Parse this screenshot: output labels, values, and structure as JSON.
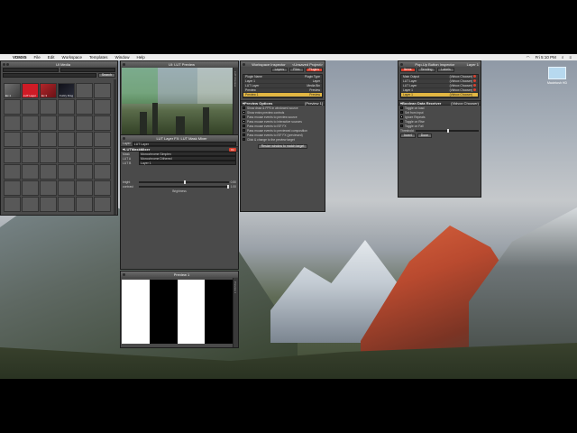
{
  "menubar": {
    "apple": "",
    "app_name": "VDMX5",
    "menus": [
      "File",
      "Edit",
      "Workspace",
      "Templates",
      "Window",
      "Help"
    ],
    "clock": "Fri 5:10 PM"
  },
  "media_panel": {
    "title": "UI Media",
    "search_label": "Search",
    "clips": [
      {
        "label": "Ex 1",
        "style": "grey-thumb"
      },
      {
        "label": "LUT Layer",
        "style": "red-thumb"
      },
      {
        "label": "Ex 3",
        "style": "red2-thumb"
      },
      {
        "label": "Fuzzy Frog",
        "style": "dark-thumb"
      }
    ]
  },
  "lut_preview": {
    "title": "UI: LUT Preview",
    "side_label": "LUT Preview"
  },
  "lut_fx": {
    "title": "LUT Layer FX: LUT Mask Mixer",
    "layer_label": "Layer",
    "layer_value": "LUT Layer",
    "section_title": "LUTMaskMixer",
    "on_label": "On",
    "rows": [
      {
        "label": "Mask",
        "value": "Monochrome Simplex"
      },
      {
        "label": "LUT A",
        "value": "Monochrome Dithered"
      },
      {
        "label": "LUT B",
        "value": "Layer 1"
      }
    ],
    "bright_label": "bright",
    "contrast_label": "contrast",
    "bright_value": "0.50",
    "contrast_value": "1.00",
    "bright_level": 0.5,
    "contrast_level": 1.0,
    "footer": "Brightness"
  },
  "preview1": {
    "title": "Preview 1",
    "side_label": "Preview 1"
  },
  "workspace_inspector": {
    "title": "Workspace Inspector",
    "project": "<Unsaved Project>",
    "tabs": [
      "Layers",
      "Files",
      "Plugins"
    ],
    "list": [
      {
        "name": "Plugin Name",
        "type": "Plugin Type"
      },
      {
        "name": "Layer 1",
        "type": "Layer"
      },
      {
        "name": "LUT Layer",
        "type": "Media Bin"
      },
      {
        "name": "Preview",
        "type": "Preview"
      },
      {
        "name": "Preview 1",
        "type": "Preview"
      }
    ],
    "options_title": "Preview Options",
    "options_tag": "[Preview 1]",
    "options": [
      "Show draw & FPS in windowed source",
      "Show extra preview controls",
      "Pass mouse events to preview source",
      "Pass mouse events to interactive sources",
      "Pass mouse events to ISF FX",
      "Pass mouse events to previewed composition",
      "Pass mouse events to ISF FX (previewed)",
      "Click & change to the preview target"
    ],
    "button_label": "Resize window to match target"
  },
  "popup_inspector": {
    "title": "Pop-Up Button Inspector",
    "target": "Layer 1",
    "tabs": [
      "Items",
      "Sending",
      "Labels"
    ],
    "list": [
      {
        "name": "Main Output",
        "value": "(Vidvox Chooser)"
      },
      {
        "name": "LUT Layer",
        "value": "(Vidvox Chooser)"
      },
      {
        "name": "LUT Layer",
        "value": "(Vidvox Chooser)"
      },
      {
        "name": "Layer 1",
        "value": "(Vidvox Chooser)"
      },
      {
        "name": "Layer 1",
        "value": "(Vidvox Chooser)"
      }
    ],
    "receiver_title": "Boolean Data Receiver",
    "receiver_tag": "(Vidvox Chooser)",
    "receiver_opts": [
      "Toggle on load",
      "Set from input",
      "Ignore Repeats",
      "Toggle on Rise",
      "Toggle on Fall"
    ],
    "threshold_label": "Threshold",
    "invert_label": "Invert",
    "done_label": "Done"
  },
  "desktop_icon": {
    "label": "Macintosh HD"
  }
}
